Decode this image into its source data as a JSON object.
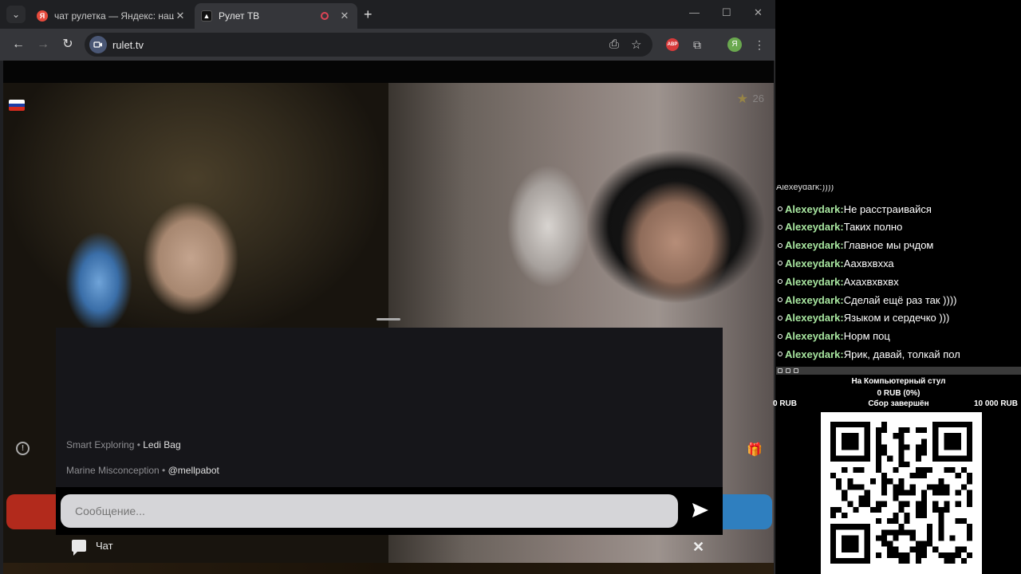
{
  "browser": {
    "tabs": [
      {
        "title": "чат рулетка — Яндекс: нашлось",
        "favicon": "yandex-icon",
        "active": false
      },
      {
        "title": "Рулет ТВ",
        "favicon": "rulet-icon",
        "active": true
      }
    ],
    "url": "rulet.tv",
    "profile_initial": "Я",
    "abp_label": "ABP"
  },
  "page": {
    "star_count": "26",
    "now_playing": [
      {
        "prefix": "Smart Exploring •",
        "value": "Ledi Bag"
      },
      {
        "prefix": "Marine Misconception •",
        "value": "@mellpabot"
      }
    ],
    "message_placeholder": "Сообщение...",
    "chat_tab_label": "Чат",
    "flag_colors": [
      "#ffffff",
      "#1c3fa8",
      "#d52b1e"
    ],
    "left_button_color": "#b22a1c",
    "right_button_color": "#2f7fbf"
  },
  "overlay": {
    "partial_top_line": "Alexeydark:))))",
    "chat": [
      {
        "user": "Alexeydark:",
        "text": "Не расстраивайся"
      },
      {
        "user": "Alexeydark:",
        "text": "Таких полно"
      },
      {
        "user": "Alexeydark:",
        "text": "Главное мы рчдом"
      },
      {
        "user": "Alexeydark:",
        "text": "Аахвхвхха"
      },
      {
        "user": "Alexeydark:",
        "text": "Ахахвхвхвх"
      },
      {
        "user": "Alexeydark:",
        "text": "Сделай ещё раз так ))))"
      },
      {
        "user": "Alexeydark:",
        "text": "Языком и сердечко )))"
      },
      {
        "user": "Alexeydark:",
        "text": "Норм поц"
      },
      {
        "user": "Alexeydark:",
        "text": "Ярик, давай, толкай пол"
      }
    ],
    "goal": {
      "title": "На Компьютерный стул",
      "amount": "0 RUB (0%)",
      "min": "0 RUB",
      "status": "Сбор завершён",
      "max": "10 000 RUB",
      "progress": 0
    }
  }
}
